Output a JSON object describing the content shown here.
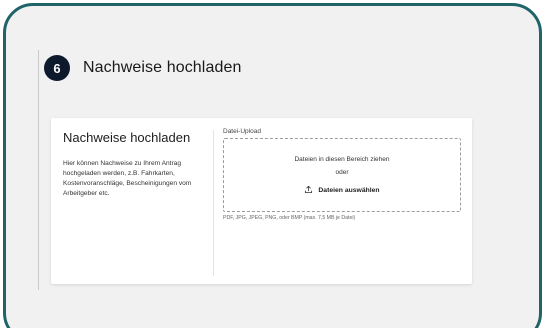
{
  "step": {
    "number": "6",
    "title": "Nachweise hochladen"
  },
  "card": {
    "title": "Nachweise hochladen",
    "description": "Hier können Nachweise zu Ihrem Antrag hochgeladen werden, z.B. Fahrkarten, Kostenvoranschläge, Bescheinigungen vom Arbeitgeber etc."
  },
  "upload": {
    "label": "Datei-Upload",
    "drop_text": "Dateien in diesen Bereich ziehen",
    "or_text": "oder",
    "button_label": "Dateien auswählen",
    "button_icon": "upload-icon",
    "hint": "PDF, JPG, JPEG, PNG, oder BMP (max. 7,5 MB je Datei)"
  },
  "colors": {
    "frame_border": "#1f6468",
    "badge": "#0c1a2b",
    "background": "#f1f1f2"
  }
}
